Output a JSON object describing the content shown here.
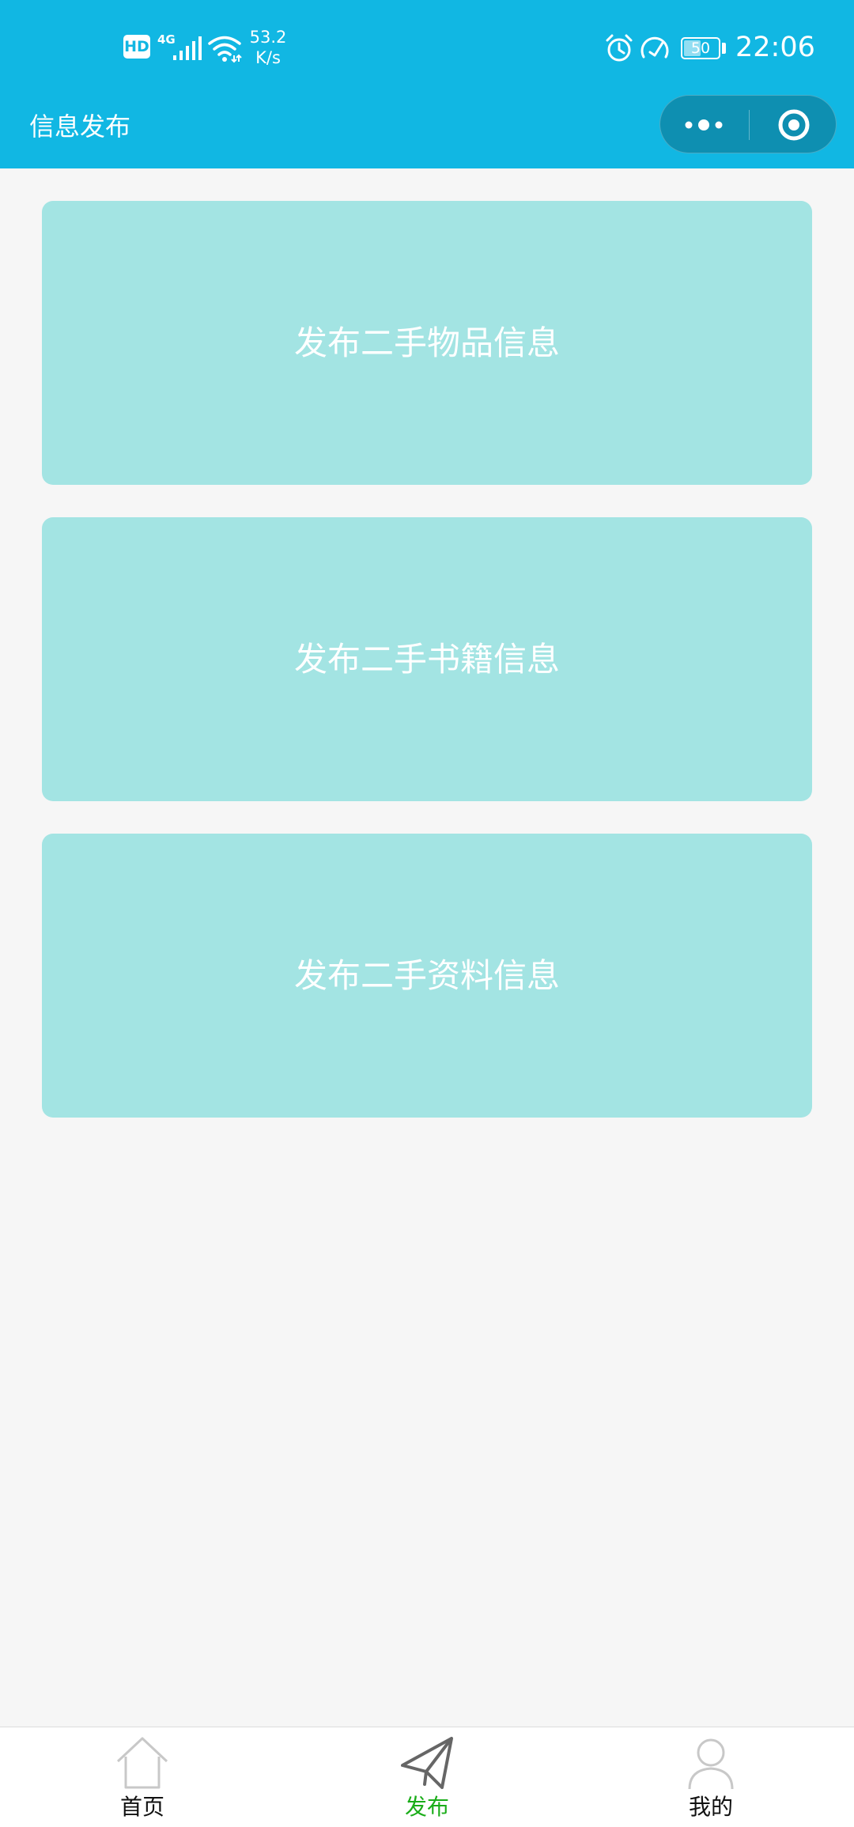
{
  "status_bar": {
    "hd_badge": "HD",
    "network_type": "4G",
    "speed_value": "53.2",
    "speed_unit": "K/s",
    "battery_level": "50",
    "time": "22:06"
  },
  "nav": {
    "title": "信息发布",
    "more_icon": "more-dots-icon",
    "close_icon": "target-circle-icon"
  },
  "cards": [
    {
      "label": "发布二手物品信息"
    },
    {
      "label": "发布二手书籍信息"
    },
    {
      "label": "发布二手资料信息"
    }
  ],
  "tabbar": {
    "items": [
      {
        "label": "首页",
        "icon": "home-icon",
        "active": false
      },
      {
        "label": "发布",
        "icon": "paper-plane-icon",
        "active": true
      },
      {
        "label": "我的",
        "icon": "user-icon",
        "active": false
      }
    ]
  },
  "colors": {
    "header_bg": "#11b7e3",
    "card_bg": "#a3e4e3",
    "page_bg": "#f6f6f6",
    "tab_active": "#1aad19"
  }
}
